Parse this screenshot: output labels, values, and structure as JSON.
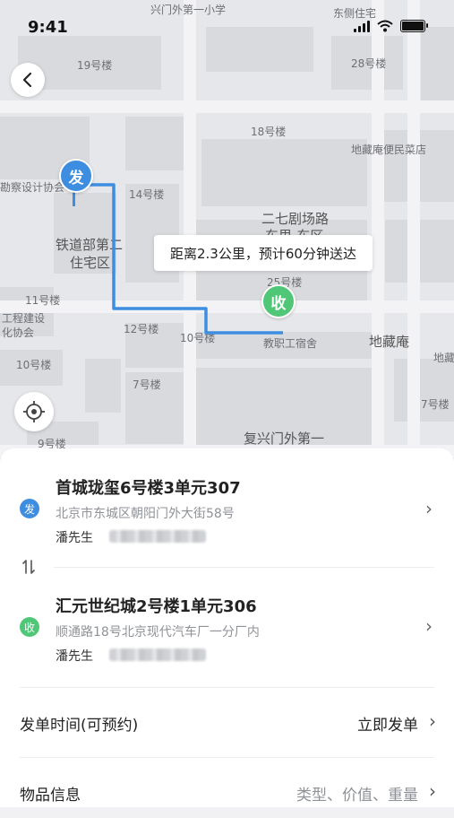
{
  "status_bar": {
    "time": "9:41"
  },
  "map": {
    "labels": [
      "兴门外第一小学",
      "东侧住宅",
      "19号楼",
      "28号楼",
      "18号楼",
      "地藏庵便民菜店",
      "勘察设计协会",
      "14号楼",
      "二七剧场路",
      "东里-东区",
      "铁道部第二",
      "住宅区",
      "11号楼",
      "25号楼",
      "工程建设",
      "化协会",
      "12号楼",
      "10号楼",
      "教职工宿舍",
      "地藏庵",
      "地藏",
      "10号楼",
      "7号楼",
      "7号楼",
      "9号楼",
      "复兴门外第一"
    ],
    "route_tooltip": "距离2.3公里，预计60分钟送达",
    "sender_pin": "发",
    "receiver_pin": "收",
    "route_color": "#3d8ee0"
  },
  "sender": {
    "badge": "发",
    "title": "首城珑玺6号楼3单元307",
    "address": "北京市东城区朝阳门外大街58号",
    "name": "潘先生",
    "badge_color": "#3d8ee0"
  },
  "receiver": {
    "badge": "收",
    "title": "汇元世纪城2号楼1单元306",
    "address": "顺通路18号北京现代汽车厂一分厂内",
    "name": "潘先生",
    "badge_color": "#4fc777"
  },
  "order_time": {
    "label": "发单时间(可预约)",
    "value": "立即发单"
  },
  "item_info": {
    "label": "物品信息",
    "value": "类型、价值、重量"
  },
  "icons": {
    "back": "chevron-left-icon",
    "locate": "locate-icon",
    "swap": "swap-icon",
    "chevron": "chevron-right-icon"
  }
}
